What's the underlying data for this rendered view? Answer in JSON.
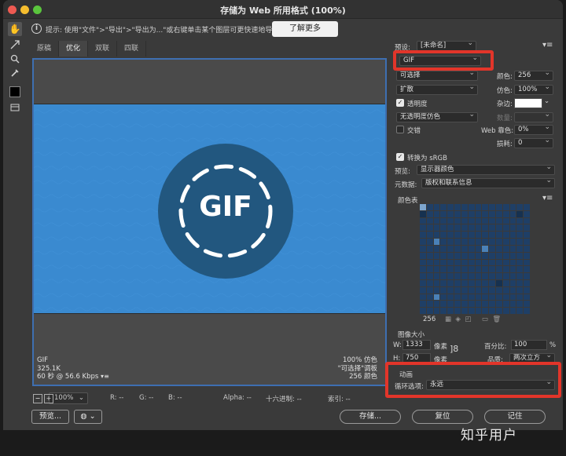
{
  "window": {
    "title": "存储为 Web 所用格式 (100%)"
  },
  "info_bar": {
    "icon": "info-icon",
    "text": "提示: 使用\"文件\">\"导出\">\"导出为...\"或右键单击某个图层可更快速地导出资源",
    "learn_more": "了解更多"
  },
  "tabs": [
    "原稿",
    "优化",
    "双联",
    "四联"
  ],
  "preview": {
    "canvas_text": "GIF",
    "left_stats": [
      "GIF",
      "325.1K",
      "60 秒 @ 56.6 Kbps"
    ],
    "right_stats": [
      "100% 仿色",
      "\"可选择\"调板",
      "256 颜色"
    ]
  },
  "status_bar": {
    "zoom": "100%",
    "r": "R: --",
    "g": "G: --",
    "b": "B: --",
    "alpha": "Alpha: --",
    "hex": "十六进制: --",
    "index": "索引: --"
  },
  "buttons": {
    "preview": "预览...",
    "save": "存储...",
    "reset": "复位",
    "remember": "记住"
  },
  "panel": {
    "preset_label": "预设:",
    "preset_value": "[未命名]",
    "format": "GIF",
    "reduction": "可选择",
    "colors_label": "颜色:",
    "colors_value": "256",
    "dither_method": "扩散",
    "dither_label": "仿色:",
    "dither_value": "100%",
    "transparency_label": "透明度",
    "matte_label": "杂边:",
    "transparency_dither": "无透明度仿色",
    "amount_label": "数量:",
    "interlaced_label": "交错",
    "web_snap_label": "Web 靠色:",
    "web_snap_value": "0%",
    "lossy_label": "损耗:",
    "lossy_value": "0",
    "convert_srgb_label": "转换为 sRGB",
    "preview_label": "预览:",
    "preview_value": "显示器颜色",
    "metadata_label": "元数据:",
    "metadata_value": "版权和联系信息",
    "color_table_label": "颜色表",
    "color_count": "256",
    "image_size_label": "图像大小",
    "w_label": "W:",
    "w_value": "1333",
    "h_label": "H:",
    "h_value": "750",
    "pixels_unit": "像素",
    "percent_label": "百分比:",
    "percent_value": "100",
    "percent_unit": "%",
    "quality_label": "品质:",
    "quality_value": "两次立方",
    "animation_label": "动画",
    "looping_label": "循环选项:",
    "looping_value": "永远"
  },
  "colors": {
    "accent_red": "#e2352a",
    "canvas_blue": "#3a8ad0",
    "circle_blue": "#22577f",
    "selection_border": "#3e6fb1"
  },
  "watermark": "知乎用户"
}
